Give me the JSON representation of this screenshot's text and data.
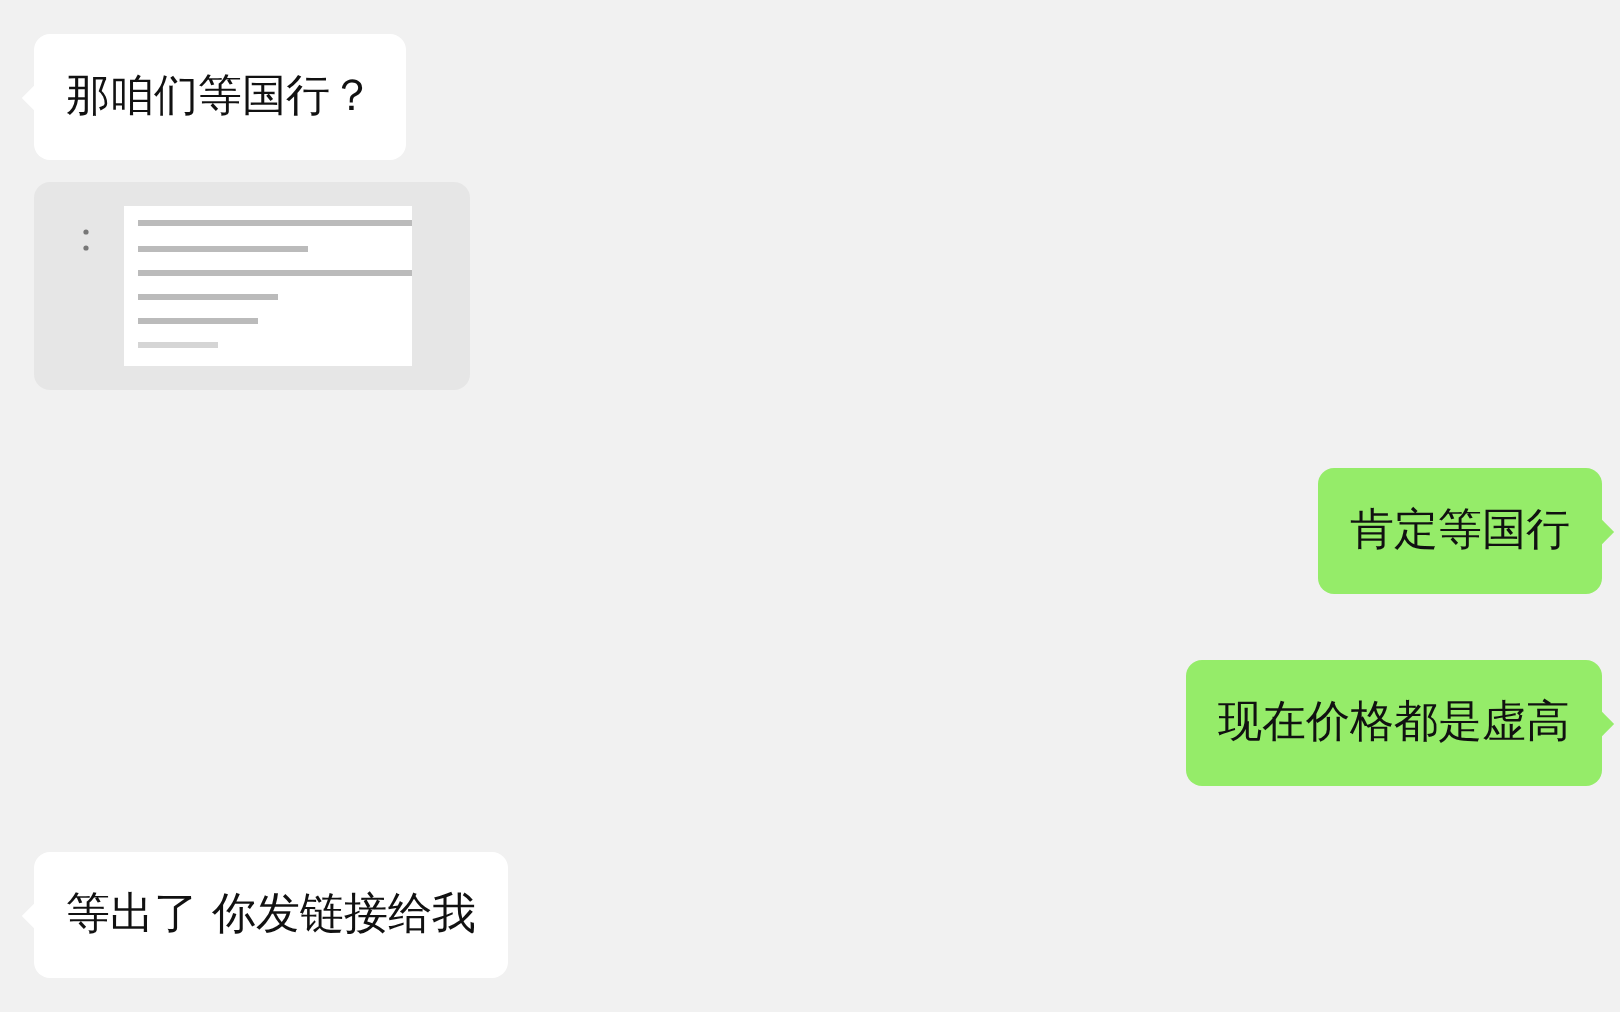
{
  "messages": [
    {
      "kind": "text",
      "sent": false,
      "text": "那咱们等国行？"
    },
    {
      "kind": "picture",
      "sent": false
    },
    {
      "kind": "text",
      "sent": true,
      "text": "肯定等国行"
    },
    {
      "kind": "text",
      "sent": true,
      "text": "现在价格都是虚高"
    },
    {
      "kind": "text",
      "sent": false,
      "text": "等出了 你发链接给我"
    }
  ]
}
